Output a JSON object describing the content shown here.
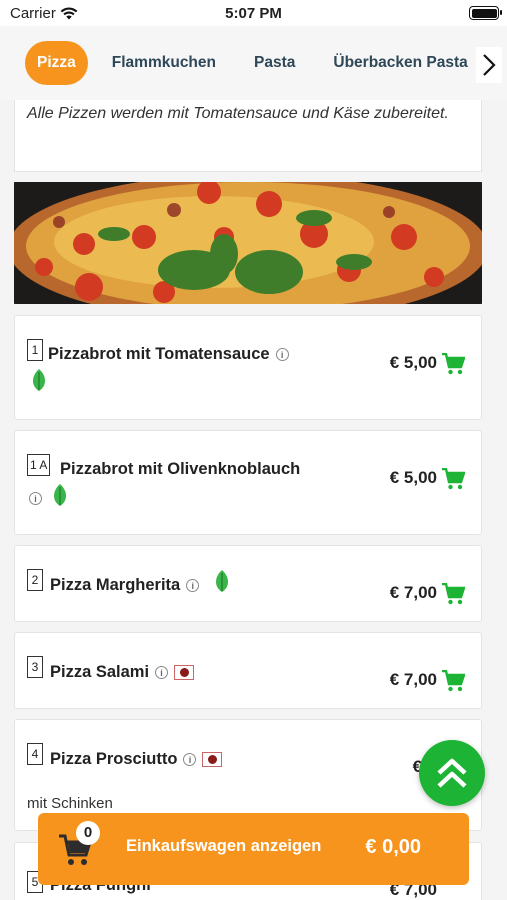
{
  "status": {
    "carrier": "Carrier",
    "time": "5:07 PM"
  },
  "tabs": [
    {
      "label": "Pizza",
      "active": true
    },
    {
      "label": "Flammkuchen",
      "active": false
    },
    {
      "label": "Pasta",
      "active": false
    },
    {
      "label": "Überbacken Pasta",
      "active": false
    }
  ],
  "note": "Alle Pizzen werden mit Tomatensauce und Käse zubereitet.",
  "items": [
    {
      "number": "1",
      "name": "Pizzabrot mit Tomatensauce",
      "price": "€ 5,00",
      "badges": [
        "vegetarian"
      ]
    },
    {
      "number": "1 A",
      "name": "Pizzabrot mit Olivenknoblauch",
      "price": "€ 5,00",
      "badges": [
        "vegetarian"
      ]
    },
    {
      "number": "2",
      "name": "Pizza Margherita",
      "price": "€ 7,00",
      "badges": [
        "vegetarian"
      ]
    },
    {
      "number": "3",
      "name": "Pizza Salami",
      "price": "€ 7,00",
      "badges": [
        "meat"
      ]
    },
    {
      "number": "4",
      "name": "Pizza Prosciutto",
      "price": "€ 7,",
      "description": "mit Schinken",
      "badges": [
        "meat"
      ]
    },
    {
      "number": "5",
      "name": "Pizza Funghi",
      "price": "€ 7,00",
      "badges": []
    }
  ],
  "cart": {
    "count": "0",
    "label": "Einkaufswagen anzeigen",
    "total": "€ 0,00"
  },
  "colors": {
    "accent": "#f7941d",
    "green": "#1db435",
    "text": "#2f4858"
  }
}
